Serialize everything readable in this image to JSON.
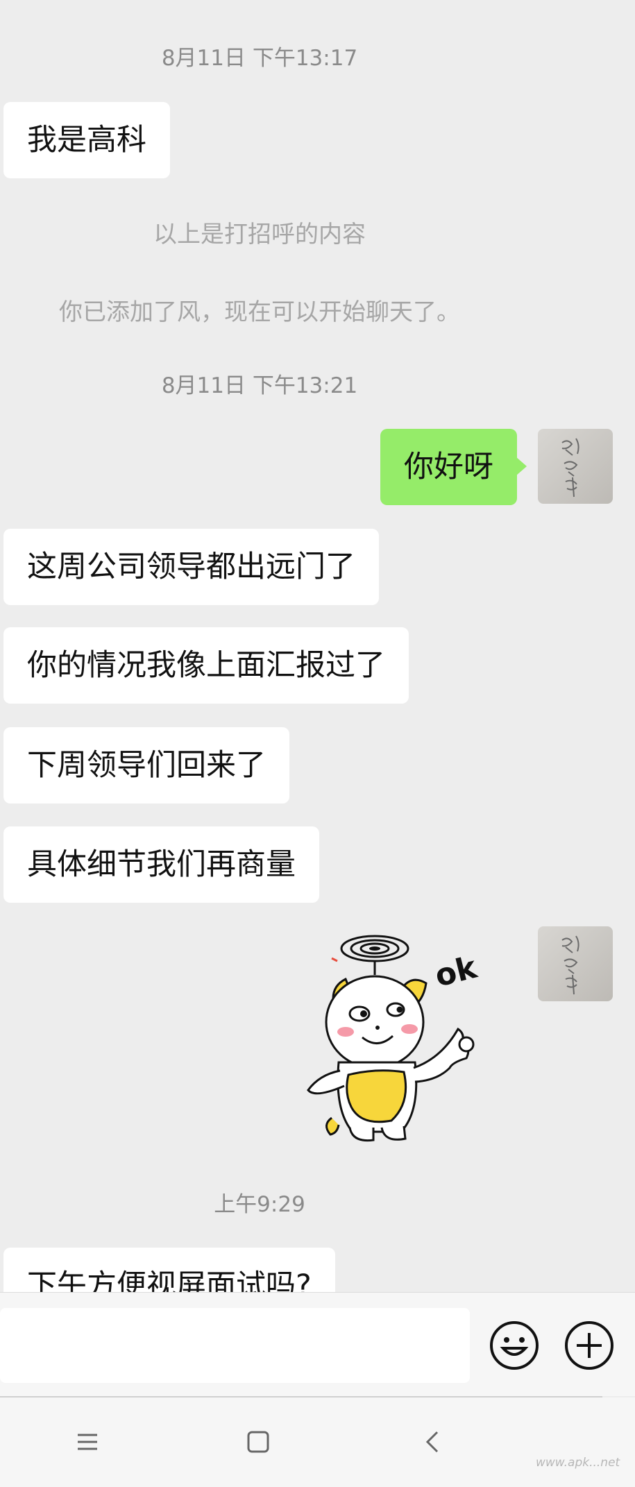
{
  "messages": {
    "time1": "8月11日 下午13:17",
    "greet_in": "我是高科",
    "sys1": "以上是打招呼的内容",
    "sys2": "你已添加了风，现在可以开始聊天了。",
    "time2": "8月11日 下午13:21",
    "out1": "你好呀",
    "in1": "这周公司领导都出远门了",
    "in2": "你的情况我像上面汇报过了",
    "in3": "下周领导们回来了",
    "in4": "具体细节我们再商量",
    "sticker_text": "ok",
    "time3": "上午9:29",
    "in5": "下午方便视屏面试吗?"
  },
  "watermark": "www.apk...net",
  "icons": {
    "emoji": "smiley-face-icon",
    "plus": "plus-circle-icon",
    "menu": "menu-lines-icon",
    "home": "home-square-icon",
    "back": "back-chevron-icon"
  },
  "colors": {
    "background": "#ededed",
    "bubble_in": "#ffffff",
    "bubble_out": "#95ec69",
    "time_text": "#8a8a8a",
    "sys_text": "#a6a6a6"
  }
}
